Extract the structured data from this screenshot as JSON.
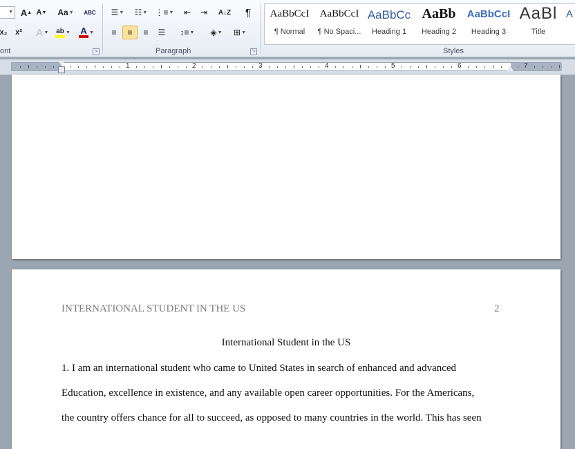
{
  "ribbon": {
    "font_group_label": "ont",
    "paragraph_group_label": "Paragraph",
    "styles_group_label": "Styles",
    "grow_font": "A",
    "shrink_font": "A",
    "change_case": "Aa",
    "subscript": "x₂",
    "superscript": "x²",
    "text_effects": "A",
    "highlight": "ab",
    "font_color": "A",
    "show_marks": "¶",
    "styles": [
      {
        "sample": "AaBbCcI",
        "name": "¶ Normal"
      },
      {
        "sample": "AaBbCcI",
        "name": "¶ No Spaci..."
      },
      {
        "sample": "AaBbCc",
        "name": "Heading 1"
      },
      {
        "sample": "AaBb",
        "name": "Heading 2"
      },
      {
        "sample": "AaBbCcI",
        "name": "Heading 3"
      },
      {
        "sample": "AaBl",
        "name": "Title"
      }
    ]
  },
  "ruler": {
    "numbers": [
      "1",
      "2",
      "3",
      "4",
      "5",
      "6",
      "7"
    ]
  },
  "document": {
    "header": "INTERNATIONAL STUDENT IN THE US",
    "page_number": "2",
    "title": "International Student in the US",
    "lines": [
      "1. I am an international student who came to United States in search of enhanced and advanced",
      "Education, excellence in existence, and any available open career opportunities. For the Americans,",
      "the country offers chance for all to succeed, as opposed to many countries in the world. This has seen"
    ]
  },
  "colors": {
    "highlight": "#ffff00",
    "font_color": "#d00000",
    "heading": "#2e5a9c"
  }
}
